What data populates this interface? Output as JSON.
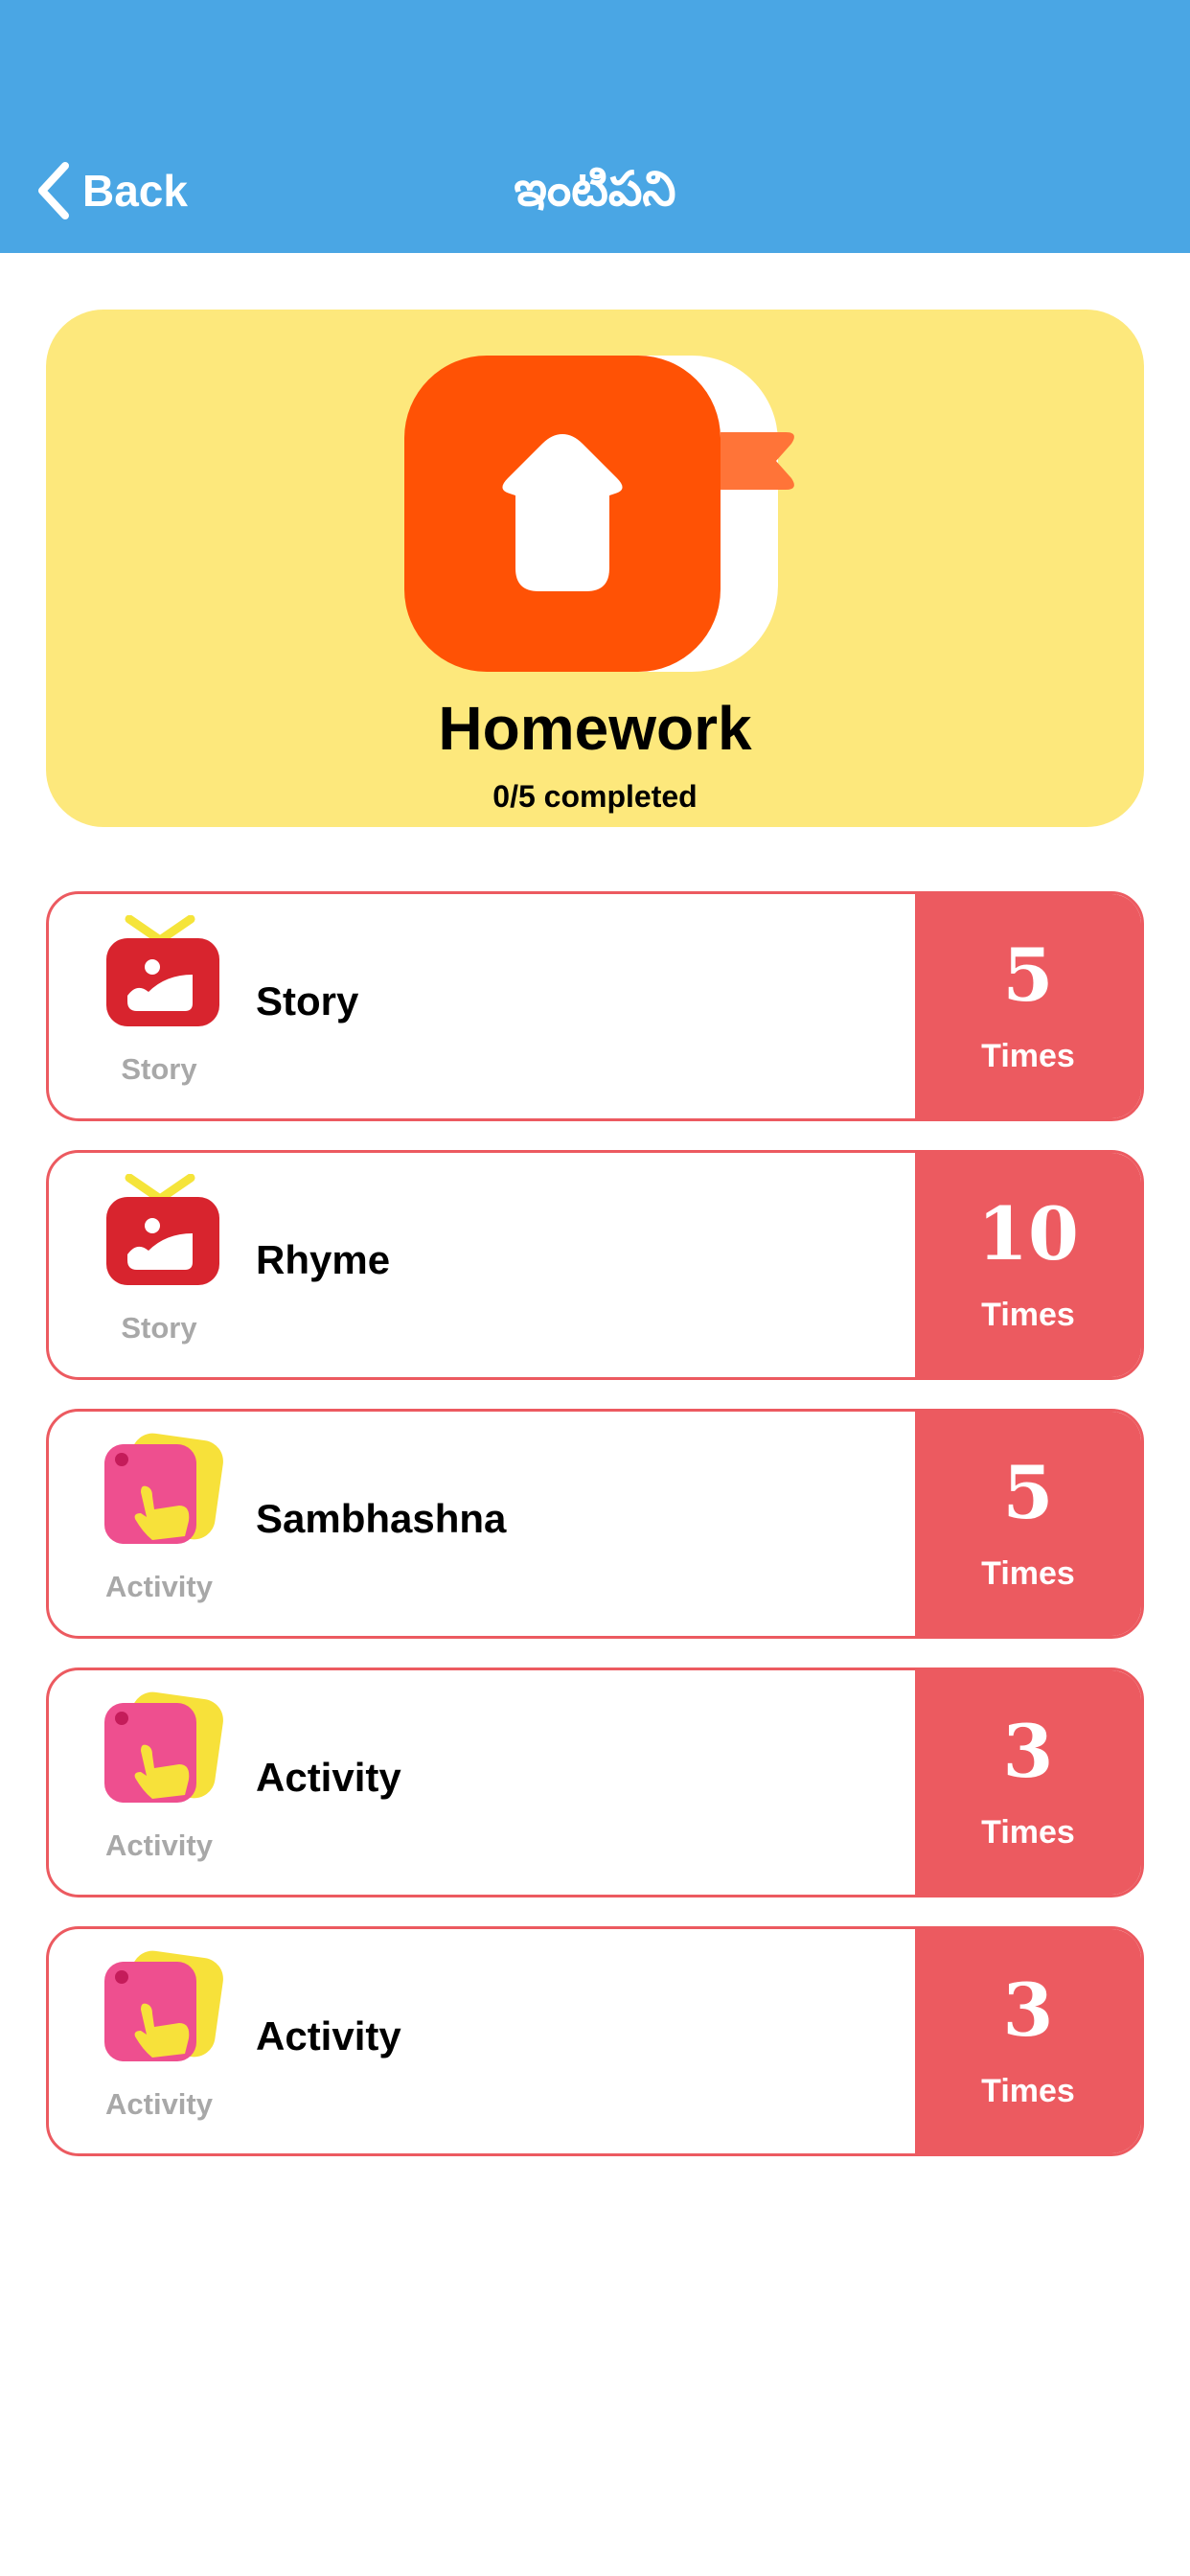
{
  "header": {
    "back_label": "Back",
    "title": "ఇంటిపని",
    "background": "#4aa6e4"
  },
  "hero": {
    "title": "Homework",
    "subtitle": "0/5 completed",
    "icon": "homework-house-icon",
    "background": "#fde87c",
    "icon_color": "#ff5205"
  },
  "tasks": [
    {
      "title": "Story",
      "type": "Story",
      "count": "5",
      "times_label": "Times",
      "icon": "story-tv-icon"
    },
    {
      "title": "Rhyme",
      "type": "Story",
      "count": "10",
      "times_label": "Times",
      "icon": "story-tv-icon"
    },
    {
      "title": "Sambhashna",
      "type": "Activity",
      "count": "5",
      "times_label": "Times",
      "icon": "activity-hand-icon"
    },
    {
      "title": "Activity",
      "type": "Activity",
      "count": "3",
      "times_label": "Times",
      "icon": "activity-hand-icon"
    },
    {
      "title": "Activity",
      "type": "Activity",
      "count": "3",
      "times_label": "Times",
      "icon": "activity-hand-icon"
    }
  ],
  "colors": {
    "accent": "#ec5a60",
    "muted_text": "#a8a8a8"
  }
}
